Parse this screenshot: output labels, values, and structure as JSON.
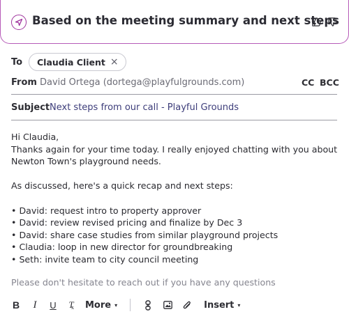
{
  "banner": {
    "title": "Based on the meeting summary and next steps",
    "icon": "send-icon",
    "accent_color": "#b65ab8"
  },
  "recipients": {
    "to_label": "To",
    "to_chip": "Claudia Client",
    "remove_glyph": "×",
    "from_label": "From",
    "from_value": "David Ortega (dortega@playfulgrounds.com)",
    "cc_label": "CC",
    "bcc_label": "BCC"
  },
  "subject": {
    "label": "Subject",
    "value": "Next steps from our call - Playful Grounds"
  },
  "message": {
    "greeting": "Hi Claudia,",
    "line1": "Thanks again for your time today. I really enjoyed chatting with you about",
    "line2": "Newton Town's playground needs.",
    "recap_intro": "As discussed, here's a quick recap and next steps:",
    "items": [
      "David: request intro to property approver",
      "David: review revised pricing and finalize by Dec 3",
      "David: share case studies from similar playground projects",
      "Claudia: loop in new director for groundbreaking",
      "Seth: invite team to city council meeting"
    ],
    "hint": "Please don't hesitate to reach out if you have any questions"
  },
  "toolbar": {
    "bold": "B",
    "italic": "I",
    "underline": "U",
    "clear_format": "T",
    "clear_format_sub": "x",
    "more_label": "More",
    "insert_label": "Insert",
    "caret": "▾"
  }
}
